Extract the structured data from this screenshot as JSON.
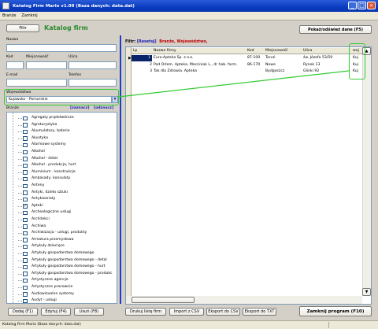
{
  "window": {
    "title": "Katalog Firm Mario v1.09 (Baza danych: data.dat)"
  },
  "menu": [
    "Branże",
    "Zamknij"
  ],
  "left": {
    "filter_button": "Filtr",
    "heading": "Katalog firm",
    "name_label": "Nazwa",
    "kod_label": "Kod",
    "miejsc_label": "Miejscowość",
    "ulica_label": "Ulica",
    "email_label": "E-mail",
    "tel_label": "Telefon",
    "woj_label": "Województwo",
    "woj_value": "Kujawsko - Pomorskie",
    "branze_label": "Branże",
    "zaznacz": "[zaznacz]",
    "odznacz": "[odznacz]",
    "branze": [
      {
        "label": "Agregaty prądotwórcze",
        "checked": false
      },
      {
        "label": "Agroturystyka",
        "checked": false
      },
      {
        "label": "Akumulatory, baterie",
        "checked": false
      },
      {
        "label": "Akustyka",
        "checked": false
      },
      {
        "label": "Alarmowe systemy",
        "checked": false
      },
      {
        "label": "Alkohol",
        "checked": false
      },
      {
        "label": "Alkohol - detal",
        "checked": false
      },
      {
        "label": "Alkohol - produkcja, hurt",
        "checked": false
      },
      {
        "label": "Aluminium - konstrukcje",
        "checked": false
      },
      {
        "label": "Ambasady, konsulaty",
        "checked": false
      },
      {
        "label": "Anteny",
        "checked": false
      },
      {
        "label": "Antyki, dzieła sztuki",
        "checked": false
      },
      {
        "label": "Antykwariaty",
        "checked": false
      },
      {
        "label": "Apteki",
        "checked": true
      },
      {
        "label": "Archeologiczne usługi",
        "checked": false
      },
      {
        "label": "Architekci",
        "checked": false
      },
      {
        "label": "Archiwa",
        "checked": false
      },
      {
        "label": "Archiwizacja - usługi, produkty",
        "checked": false
      },
      {
        "label": "Armatura przemysłowa",
        "checked": false
      },
      {
        "label": "Artykuły dziecięce",
        "checked": false
      },
      {
        "label": "Artykuły gospodarstwa domowego",
        "checked": false
      },
      {
        "label": "Artykuły gospodarstwa domowego - detal",
        "checked": false
      },
      {
        "label": "Artykuły gospodarstwa domowego - hurt",
        "checked": false
      },
      {
        "label": "Artykuły gospodarstwa domowego - produkc",
        "checked": false
      },
      {
        "label": "Artystyczne agencje",
        "checked": false
      },
      {
        "label": "Artystyczne pracownie",
        "checked": false
      },
      {
        "label": "Audiowizualne systemy",
        "checked": false
      },
      {
        "label": "Audyt - usługi",
        "checked": false
      }
    ],
    "btn_dodaj": "Dodaj (F1)",
    "btn_edytuj": "Edytuj (F4)",
    "btn_usun": "Usuń (F8)"
  },
  "right": {
    "refresh_button": "Pokaż/odśwież dane (F5)",
    "filter_label": "Filtr:",
    "resetuj": "[Resetuj]",
    "filter_text": "Branże, Województwo,",
    "columns": [
      "Lp",
      "Nazwa firmy",
      "Kod",
      "Miejscowość",
      "Ulica",
      "woj"
    ],
    "rows": [
      {
        "lp": "1",
        "name": "Euro-Apteka Sp. z o.o.",
        "kod": "87-100",
        "miejsc": "Toruń",
        "ulica": "św. Józefa 53/59",
        "woj": "Kuj"
      },
      {
        "lp": "2",
        "name": "Pod Orłem. Apteka. Marciniak L., dr hab. farm.",
        "kod": "86-170",
        "miejsc": "Nowe",
        "ulica": "Rynek 13",
        "woj": "Kuj"
      },
      {
        "lp": "3",
        "name": "Tak dla Zdrowia. Apteka",
        "kod": "",
        "miejsc": "Bydgoszcz",
        "ulica": "Glinki 92",
        "woj": "Kuj"
      }
    ],
    "btn_drukuj": "Drukuj listę firm",
    "btn_import": "Import z CSV",
    "btn_eksport_csv": "Eksport do CSV",
    "btn_eksport_txt": "Eksport do TXT",
    "btn_zamknij": "Zamknij program (F10)"
  },
  "status": "Katalog Firm Mario (Baza danych: data.dat)",
  "colors": {
    "heading": "#2e8b2e",
    "highlight": "#33cc33",
    "link": "#1a1ab0",
    "filter": "#c00000",
    "selection": "#0a246a"
  }
}
